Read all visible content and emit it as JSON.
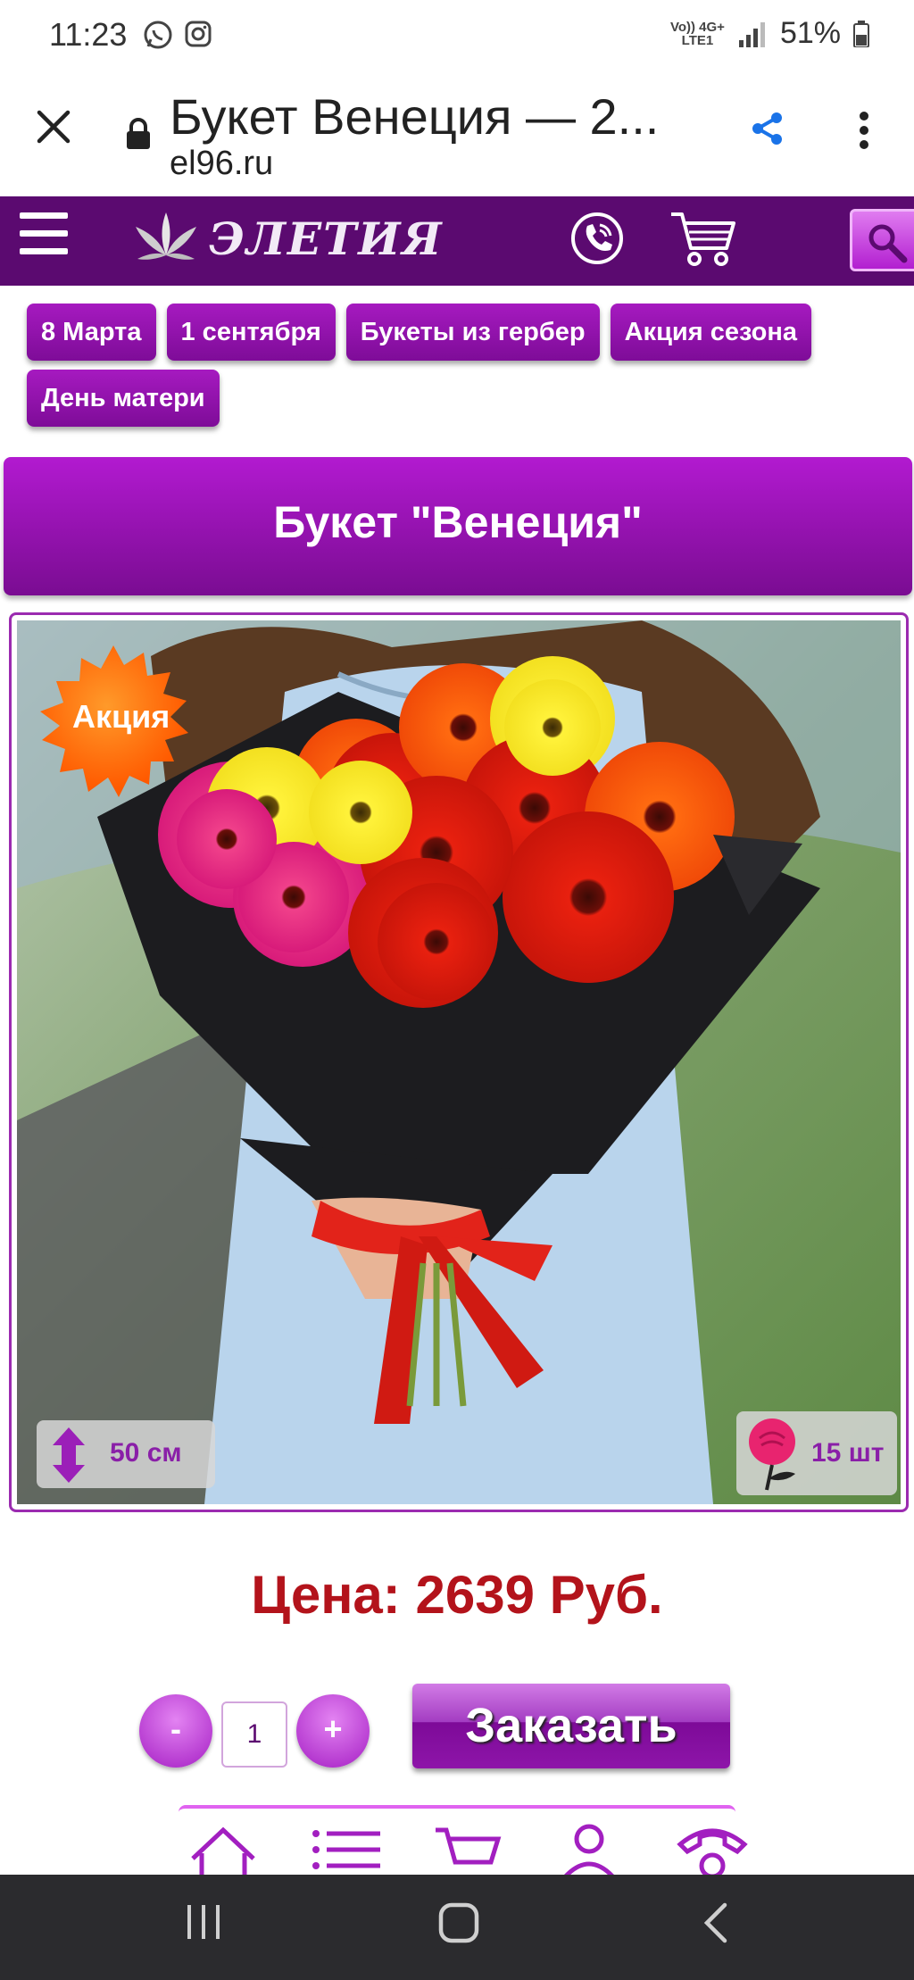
{
  "status_bar": {
    "time": "11:23",
    "network_top": "Vo)) 4G+",
    "network_bottom": "LTE1",
    "battery": "51%"
  },
  "browser": {
    "page_title": "Букет Венеция — 2...",
    "url": "el96.ru"
  },
  "site_header": {
    "logo_text": "ЭЛЕТИЯ"
  },
  "tags": [
    "8 Марта",
    "1 сентября",
    "Букеты из гербер",
    "Акция сезона",
    "День матери"
  ],
  "product": {
    "title": "Букет \"Венеция\"",
    "promo_badge": "Акция",
    "height": "50 см",
    "count": "15 шт",
    "price": "Цена: 2639 Руб."
  },
  "order": {
    "minus_label": "-",
    "quantity": "1",
    "plus_label": "+",
    "order_label": "Заказать"
  },
  "colors": {
    "header_purple": "#5b0a70",
    "tag_purple": "#8e12a8",
    "price_red": "#b3131b"
  }
}
